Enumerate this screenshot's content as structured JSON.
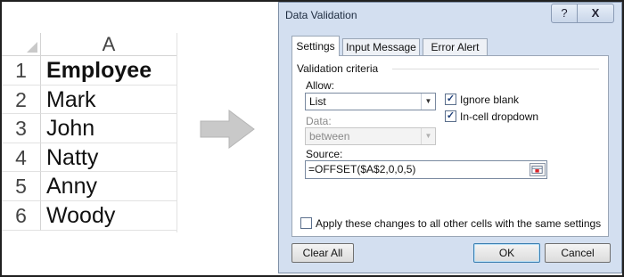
{
  "sheet": {
    "column_header": "A",
    "rows": [
      {
        "num": "1",
        "value": "Employee"
      },
      {
        "num": "2",
        "value": "Mark"
      },
      {
        "num": "3",
        "value": "John"
      },
      {
        "num": "4",
        "value": "Natty"
      },
      {
        "num": "5",
        "value": "Anny"
      },
      {
        "num": "6",
        "value": "Woody"
      }
    ]
  },
  "dialog": {
    "title": "Data Validation",
    "help_glyph": "?",
    "close_glyph": "X",
    "tabs": [
      "Settings",
      "Input Message",
      "Error Alert"
    ],
    "active_tab": "Settings",
    "criteria_heading": "Validation criteria",
    "allow_label": "Allow:",
    "allow_value": "List",
    "data_label": "Data:",
    "data_value": "between",
    "ignore_blank_label": "Ignore blank",
    "ignore_blank_checked": true,
    "in_cell_dropdown_label": "In-cell dropdown",
    "in_cell_dropdown_checked": true,
    "source_label": "Source:",
    "source_value": "=OFFSET($A$2,0,0,5)",
    "apply_all_label": "Apply these changes to all other cells with the same settings",
    "apply_all_checked": false,
    "clear_all_label": "Clear All",
    "ok_label": "OK",
    "cancel_label": "Cancel"
  },
  "icons": {
    "arrow": "right-arrow-icon",
    "dropdown": "chevron-down-icon",
    "check": "checkmark-icon",
    "range_picker": "range-select-icon"
  },
  "colors": {
    "dialog_bg": "#d3dff0",
    "arrow_fill": "#c9c9c9",
    "check_color": "#1d3e78"
  }
}
